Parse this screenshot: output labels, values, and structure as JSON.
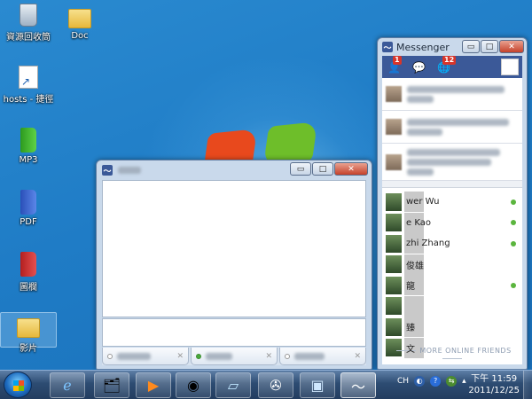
{
  "desktop": {
    "icons": [
      {
        "label": "資源回收筒",
        "icon": "recycle-bin-icon"
      },
      {
        "label": "Doc",
        "icon": "folder-icon"
      },
      {
        "label": "hosts - 捷徑",
        "icon": "shortcut-icon"
      },
      {
        "label": "MP3",
        "icon": "green-book-icon"
      },
      {
        "label": "PDF",
        "icon": "blue-book-icon"
      },
      {
        "label": "圖欄",
        "icon": "red-book-icon"
      },
      {
        "label": "影片",
        "icon": "folder-icon"
      }
    ]
  },
  "chat_window": {
    "tabs": [
      {
        "label": "",
        "online": false
      },
      {
        "label": "",
        "online": true
      },
      {
        "label": "",
        "online": false
      }
    ],
    "buttons": {
      "minimize": "▭",
      "maximize": "□",
      "close": "✕"
    }
  },
  "messenger": {
    "title": "Messenger",
    "notifications": {
      "friend_requests": "1",
      "notifications": "12"
    },
    "friends": [
      {
        "name": "wer Wu",
        "online": true
      },
      {
        "name": "e Kao",
        "online": true
      },
      {
        "name": "zhi Zhang",
        "online": true
      },
      {
        "name": "俊雄",
        "online": false
      },
      {
        "name": "龍",
        "online": true
      },
      {
        "name": "",
        "online": false
      },
      {
        "name": "臻",
        "online": false
      },
      {
        "name": "文",
        "online": false
      }
    ],
    "more_label": "MORE ONLINE FRIENDS"
  },
  "taskbar": {
    "language": "CH",
    "time": "下午 11:59",
    "date": "2011/12/25"
  },
  "colors": {
    "facebook_blue": "#3b5998",
    "online_green": "#5bb53e",
    "badge_red": "#d8352a"
  }
}
